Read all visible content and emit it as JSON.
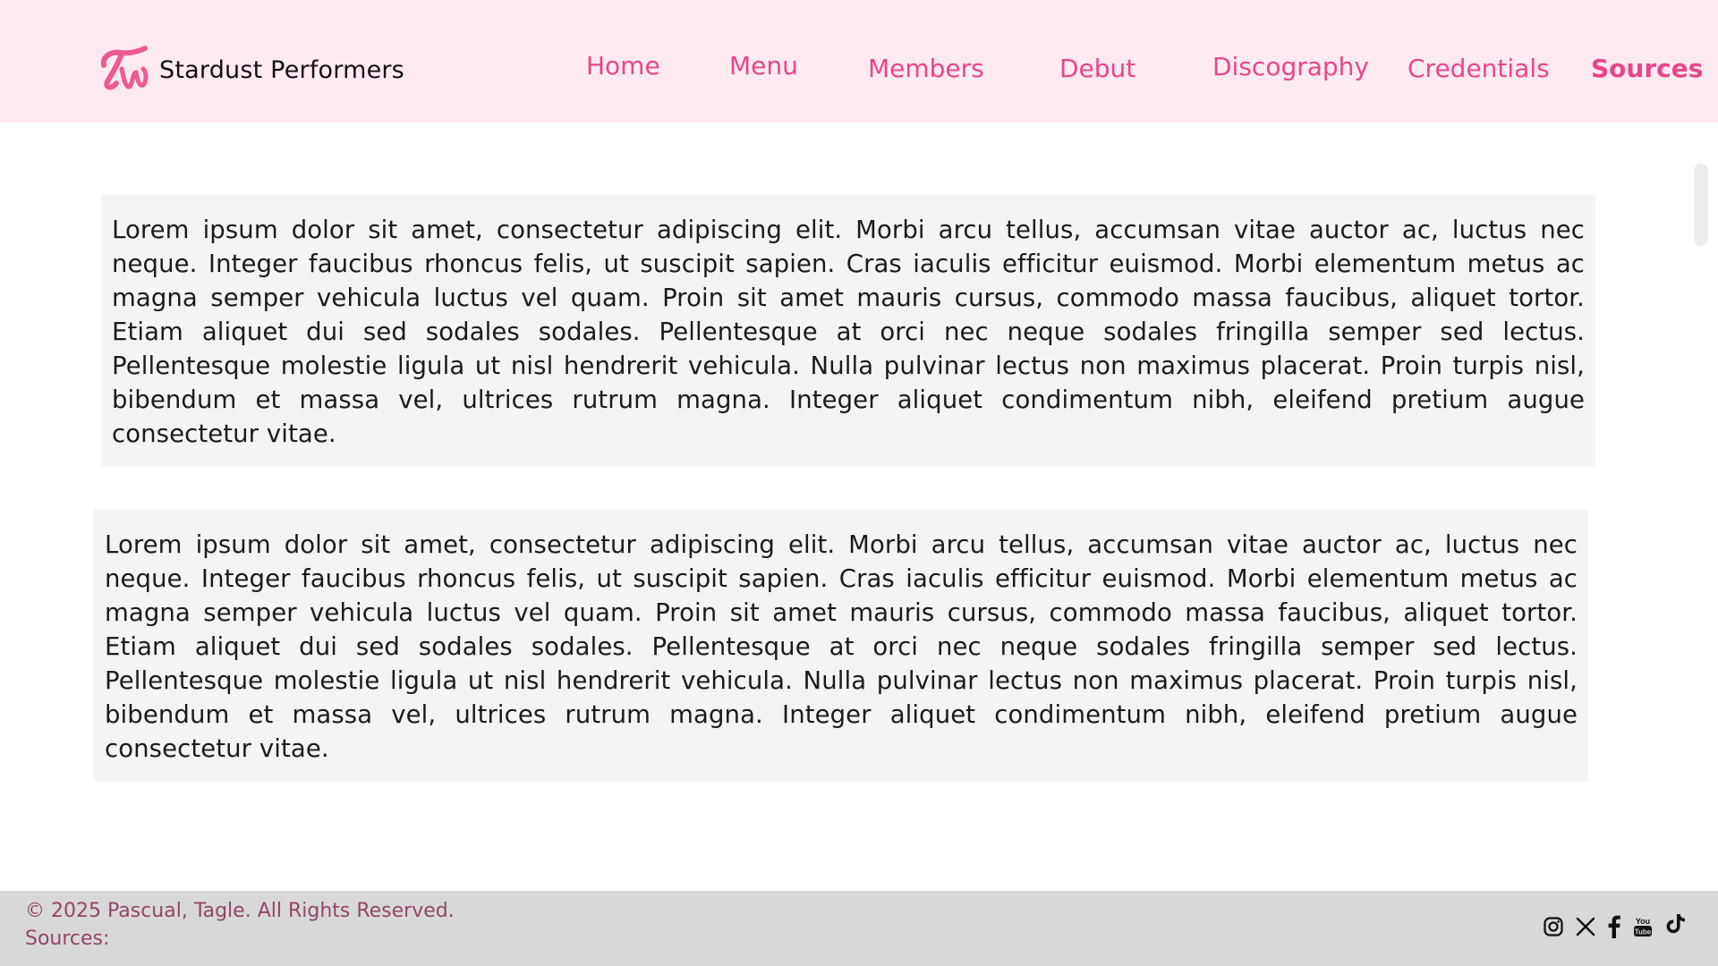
{
  "header": {
    "brand_name": "Stardust Performers",
    "nav": [
      {
        "label": "Home"
      },
      {
        "label": "Menu"
      },
      {
        "label": "Members"
      },
      {
        "label": "Debut"
      },
      {
        "label": "Discography"
      },
      {
        "label": "Credentials"
      },
      {
        "label": "Sources"
      }
    ],
    "active_nav": "Sources"
  },
  "main": {
    "cards": [
      {
        "text": "Lorem ipsum dolor sit amet, consectetur adipiscing elit. Morbi arcu tellus, accumsan vitae auctor ac, luctus nec neque. Integer faucibus rhoncus felis, ut suscipit sapien. Cras iaculis efficitur euismod. Morbi elementum metus ac magna semper vehicula luctus vel quam. Proin sit amet mauris cursus, commodo massa faucibus, aliquet tortor. Etiam aliquet dui sed sodales sodales. Pellentesque at orci nec neque sodales fringilla semper sed lectus. Pellentesque molestie ligula ut nisl hendrerit vehicula. Nulla pulvinar lectus non maximus placerat. Proin turpis nisl, bibendum et massa vel, ultrices rutrum magna. Integer aliquet condimentum nibh, eleifend pretium augue consectetur vitae."
      },
      {
        "text": "Lorem ipsum dolor sit amet, consectetur adipiscing elit. Morbi arcu tellus, accumsan vitae auctor ac, luctus nec neque. Integer faucibus rhoncus felis, ut suscipit sapien. Cras iaculis efficitur euismod. Morbi elementum metus ac magna semper vehicula luctus vel quam. Proin sit amet mauris cursus, commodo massa faucibus, aliquet tortor. Etiam aliquet dui sed sodales sodales. Pellentesque at orci nec neque sodales fringilla semper sed lectus. Pellentesque molestie ligula ut nisl hendrerit vehicula. Nulla pulvinar lectus non maximus placerat. Proin turpis nisl, bibendum et massa vel, ultrices rutrum magna. Integer aliquet condimentum nibh, eleifend pretium augue consectetur vitae."
      }
    ]
  },
  "footer": {
    "copyright": "© 2025 Pascual, Tagle. All Rights Reserved.",
    "sources_label": "Sources:",
    "social_icons": [
      "instagram-icon",
      "x-icon",
      "facebook-icon",
      "youtube-icon",
      "tiktok-icon"
    ]
  },
  "colors": {
    "header_bg": "#ffeaf2",
    "nav_text": "#e8468a",
    "card_bg": "#f3f4f3",
    "footer_bg": "#d8d8d8",
    "footer_text": "#8f4868"
  }
}
